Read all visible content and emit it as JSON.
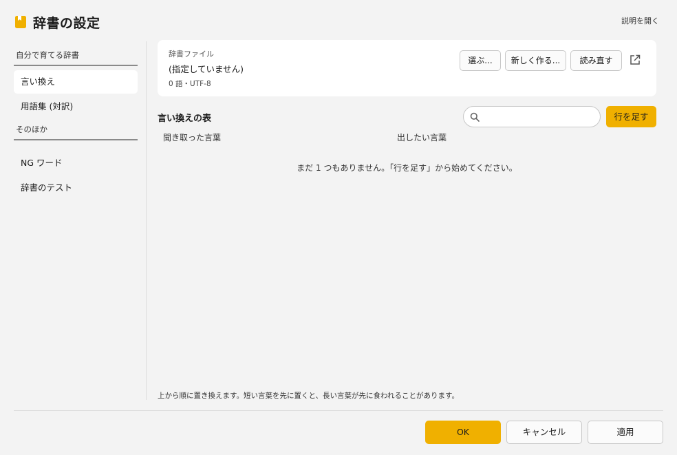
{
  "header": {
    "title": "辞書の設定",
    "help_link": "説明を開く",
    "icon": "book-icon",
    "accent_color": "#f0b000"
  },
  "sidebar": {
    "sections": [
      {
        "title": "自分で育てる辞書",
        "items": [
          {
            "label": "言い換え",
            "selected": true
          },
          {
            "label": "用語集 (対訳)",
            "selected": false
          }
        ]
      },
      {
        "title": "そのほか",
        "items": [
          {
            "label": "NG ワード",
            "selected": false
          },
          {
            "label": "辞書のテスト",
            "selected": false
          }
        ]
      }
    ]
  },
  "file_card": {
    "label": "辞書ファイル",
    "value": "(指定していません)",
    "meta": "0 語・UTF-8",
    "buttons": {
      "choose": "選ぶ...",
      "create": "新しく作る...",
      "reload": "読み直す"
    },
    "open_icon": "external-link-icon"
  },
  "table": {
    "title": "言い換えの表",
    "search_placeholder": "",
    "search_icon": "search-icon",
    "add_row": "行を足す",
    "columns": [
      "聞き取った言葉",
      "出したい言葉"
    ],
    "empty_message": "まだ 1 つもありません。「行を足す」から始めてください。",
    "footnote": "上から順に置き換えます。短い言葉を先に置くと、長い言葉が先に食われることがあります。"
  },
  "footer": {
    "ok": "OK",
    "cancel": "キャンセル",
    "apply": "適用"
  }
}
